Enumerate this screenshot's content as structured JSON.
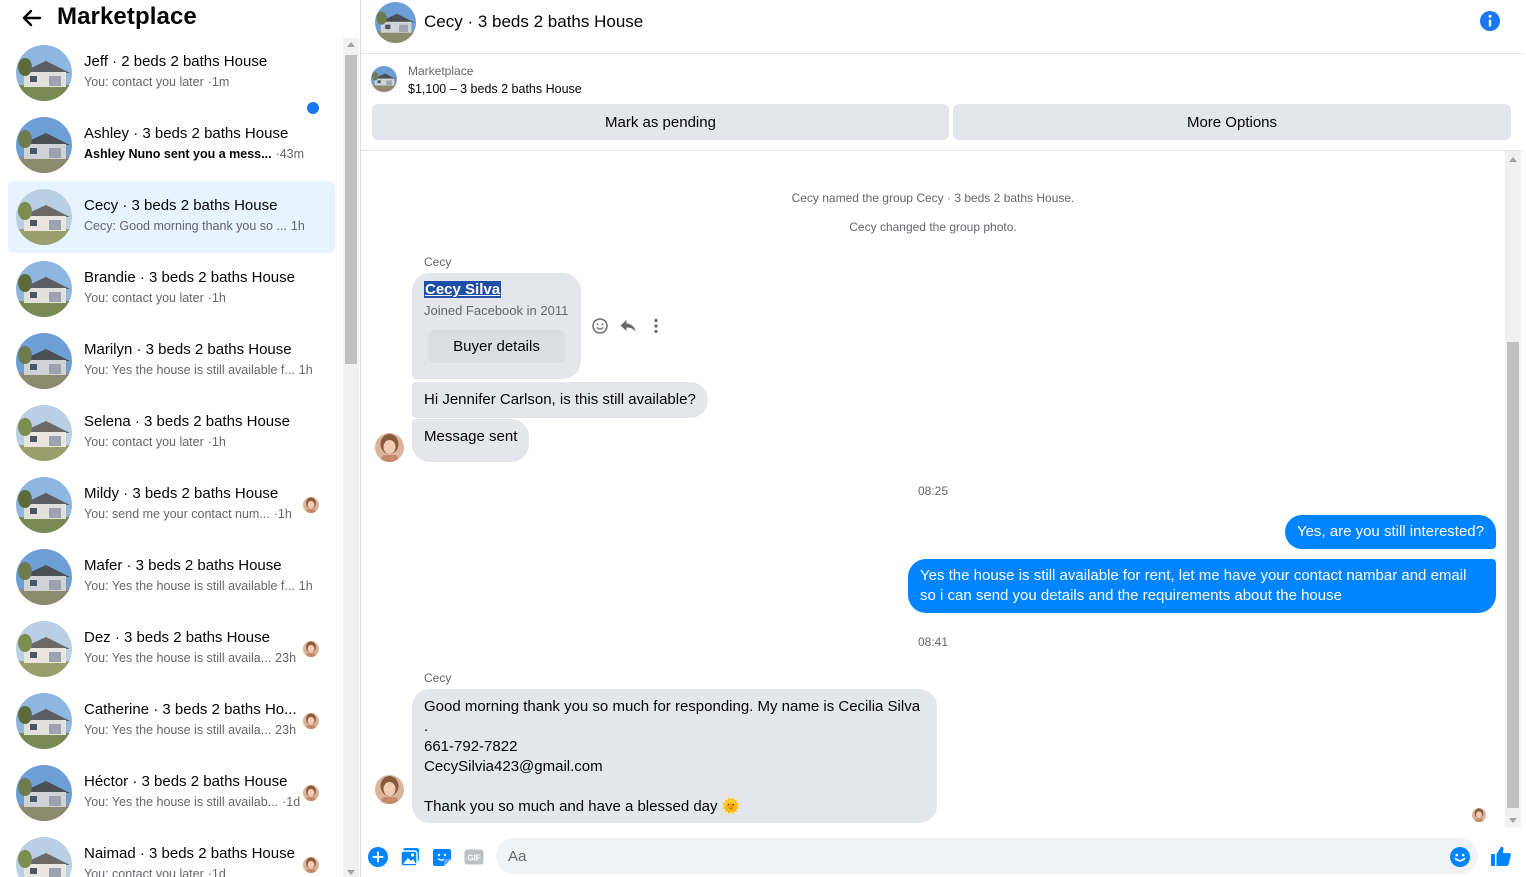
{
  "sidebar": {
    "title": "Marketplace",
    "back_icon": "arrow-left-icon",
    "conversations": [
      {
        "name": "Jeff · 2 beds 2 baths House",
        "snippet": "You: contact you later",
        "time": "·1m",
        "unread": false,
        "active": false
      },
      {
        "name": "Ashley · 3 beds 2 baths House",
        "snippet": "Ashley Nuno sent you a mess...",
        "time": "·43m",
        "unread": true,
        "active": false
      },
      {
        "name": "Cecy · 3 beds 2 baths House",
        "snippet": "Cecy: Good morning thank you so ...",
        "time": "1h",
        "unread": false,
        "active": true
      },
      {
        "name": "Brandie · 3 beds 2 baths House",
        "snippet": "You: contact you later",
        "time": "·1h",
        "unread": false,
        "active": false
      },
      {
        "name": "Marilyn · 3 beds 2 baths House",
        "snippet": "You: Yes the house is still available f...",
        "time": "1h",
        "unread": false,
        "active": false
      },
      {
        "name": "Selena · 3 beds 2 baths House",
        "snippet": "You: contact you later",
        "time": "·1h",
        "unread": false,
        "active": false
      },
      {
        "name": "Mildy · 3 beds 2 baths House",
        "snippet": "You: send me your contact num...",
        "time": "·1h",
        "unread": false,
        "active": false
      },
      {
        "name": "Mafer · 3 beds 2 baths House",
        "snippet": "You: Yes the house is still available f...",
        "time": "1h",
        "unread": false,
        "active": false
      },
      {
        "name": "Dez · 3 beds 2 baths House",
        "snippet": "You: Yes the house is still availa...",
        "time": "23h",
        "unread": false,
        "active": false
      },
      {
        "name": "Catherine · 3 beds 2 baths Ho...",
        "snippet": "You: Yes the house is still availa...",
        "time": "23h",
        "unread": false,
        "active": false
      },
      {
        "name": "Héctor · 3 beds 2 baths House",
        "snippet": "You: Yes the house is still availab...",
        "time": "·1d",
        "unread": false,
        "active": false
      },
      {
        "name": "Naimad · 3 beds 2 baths House",
        "snippet": "You: contact you later",
        "time": "·1d",
        "unread": false,
        "active": false
      }
    ]
  },
  "chat": {
    "title": "Cecy · 3 beds 2 baths House",
    "info_icon": "info-icon",
    "listing": {
      "label": "Marketplace",
      "description": "$1,100 – 3 beds 2 baths House",
      "pending_label": "Mark as pending",
      "more_label": "More Options"
    },
    "system_messages": [
      "Cecy named the group Cecy · 3 beds 2 baths House.",
      "Cecy changed the group photo."
    ],
    "sender_name": "Cecy",
    "profile_card": {
      "name": "Cecy Silva",
      "joined": "Joined Facebook in 2011",
      "button": "Buyer details"
    },
    "incoming_1": "Hi Jennifer Carlson, is this still available?",
    "incoming_2": "Message sent",
    "time_1": "08:25",
    "outgoing_1": "Yes, are you still interested?",
    "outgoing_2": "Yes the house is still available for rent, let me have your contact nambar and email so i can send you details and the requirements about the house",
    "time_2": "08:41",
    "sender_name_2": "Cecy",
    "incoming_3_lines": [
      "Good morning thank you so much for responding. My name is Cecilia Silva .",
      "661-792-7822",
      "CecySilvia423@gmail.com",
      "",
      "Thank you so much and have a blessed day 🌞"
    ],
    "composer": {
      "placeholder": "Aa"
    }
  },
  "colors": {
    "accent": "#0084ff",
    "incoming_bubble": "#e4e6eb",
    "active_row": "#e7f3ff",
    "unread_dot": "#1877f2"
  }
}
